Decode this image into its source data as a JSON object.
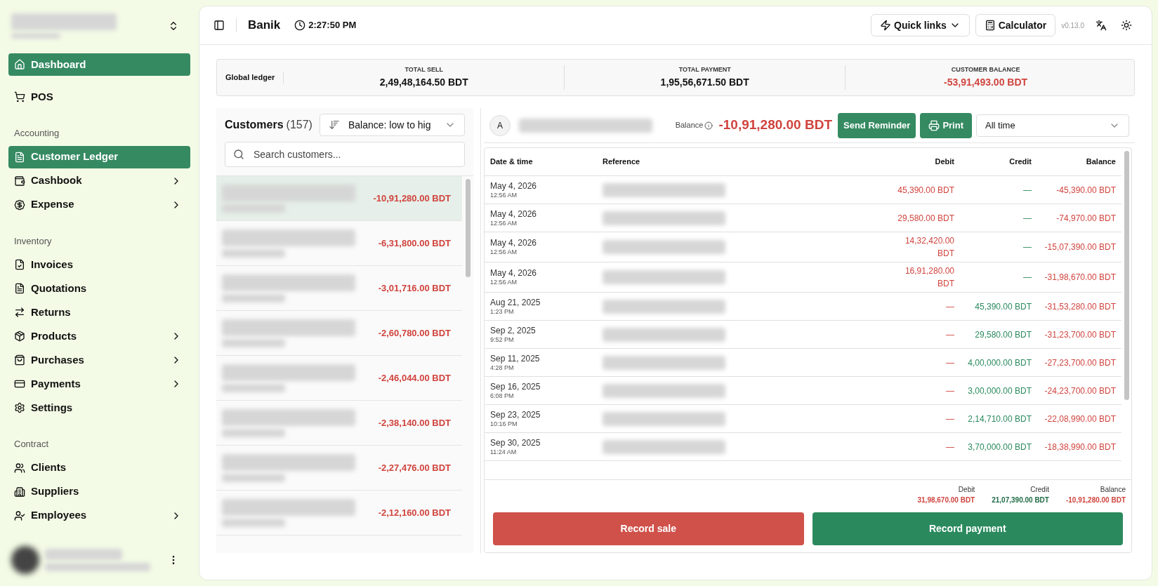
{
  "sidebar": {
    "sections": [
      {
        "items": [
          {
            "label": "Dashboard",
            "selected": true,
            "has_submenu": false
          },
          {
            "label": "POS",
            "selected": false,
            "has_submenu": false
          }
        ]
      },
      {
        "heading": "Accounting",
        "items": [
          {
            "label": "Customer Ledger",
            "selected": true,
            "has_submenu": false
          },
          {
            "label": "Cashbook",
            "selected": false,
            "has_submenu": true
          },
          {
            "label": "Expense",
            "selected": false,
            "has_submenu": true
          }
        ]
      },
      {
        "heading": "Inventory",
        "items": [
          {
            "label": "Invoices",
            "selected": false,
            "has_submenu": false
          },
          {
            "label": "Quotations",
            "selected": false,
            "has_submenu": false
          },
          {
            "label": "Returns",
            "selected": false,
            "has_submenu": false
          },
          {
            "label": "Products",
            "selected": false,
            "has_submenu": true
          },
          {
            "label": "Purchases",
            "selected": false,
            "has_submenu": true
          },
          {
            "label": "Payments",
            "selected": false,
            "has_submenu": true
          },
          {
            "label": "Settings",
            "selected": false,
            "has_submenu": false
          }
        ]
      },
      {
        "heading": "Contract",
        "items": [
          {
            "label": "Clients",
            "selected": false,
            "has_submenu": false
          },
          {
            "label": "Suppliers",
            "selected": false,
            "has_submenu": false
          },
          {
            "label": "Employees",
            "selected": false,
            "has_submenu": true
          }
        ]
      }
    ]
  },
  "topbar": {
    "title": "Banik",
    "time": "2:27:50 PM",
    "quick_links": "Quick links",
    "calculator": "Calculator",
    "version": "v0.13.0"
  },
  "summary": {
    "label": "Global ledger",
    "stats": [
      {
        "label": "TOTAL SELL",
        "value": "2,49,48,164.50 BDT",
        "negative": false
      },
      {
        "label": "TOTAL PAYMENT",
        "value": "1,95,56,671.50 BDT",
        "negative": false
      },
      {
        "label": "CUSTOMER BALANCE",
        "value": "-53,91,493.00 BDT",
        "negative": true
      }
    ]
  },
  "customers": {
    "title": "Customers",
    "count": "(157)",
    "sort": "Balance: low to hig",
    "search_placeholder": "Search customers...",
    "rows": [
      {
        "balance": "-10,91,280.00 BDT",
        "selected": true
      },
      {
        "balance": "-6,31,800.00 BDT",
        "selected": false
      },
      {
        "balance": "-3,01,716.00 BDT",
        "selected": false
      },
      {
        "balance": "-2,60,780.00 BDT",
        "selected": false
      },
      {
        "balance": "-2,46,044.00 BDT",
        "selected": false
      },
      {
        "balance": "-2,38,140.00 BDT",
        "selected": false
      },
      {
        "balance": "-2,27,476.00 BDT",
        "selected": false
      },
      {
        "balance": "-2,12,160.00 BDT",
        "selected": false
      }
    ]
  },
  "ledger": {
    "avatar": "A",
    "balance_label": "Balance",
    "balance": "-10,91,280.00 BDT",
    "send_reminder": "Send Reminder",
    "print": "Print",
    "period": "All time",
    "columns": [
      "Date & time",
      "Reference",
      "Debit",
      "Credit",
      "Balance"
    ],
    "rows": [
      {
        "date": "May 4, 2026",
        "time": "12:56 AM",
        "debit": "45,390.00 BDT",
        "credit": "—",
        "balance": "-45,390.00 BDT"
      },
      {
        "date": "May 4, 2026",
        "time": "12:56 AM",
        "debit": "29,580.00 BDT",
        "credit": "—",
        "balance": "-74,970.00 BDT"
      },
      {
        "date": "May 4, 2026",
        "time": "12:56 AM",
        "debit": "14,32,420.00 BDT",
        "credit": "—",
        "balance": "-15,07,390.00 BDT"
      },
      {
        "date": "May 4, 2026",
        "time": "12:56 AM",
        "debit": "16,91,280.00 BDT",
        "credit": "—",
        "balance": "-31,98,670.00 BDT"
      },
      {
        "date": "Aug 21, 2025",
        "time": "1:23 PM",
        "debit": "—",
        "credit": "45,390.00 BDT",
        "balance": "-31,53,280.00 BDT"
      },
      {
        "date": "Sep 2, 2025",
        "time": "9:52 PM",
        "debit": "—",
        "credit": "29,580.00 BDT",
        "balance": "-31,23,700.00 BDT"
      },
      {
        "date": "Sep 11, 2025",
        "time": "4:28 PM",
        "debit": "—",
        "credit": "4,00,000.00 BDT",
        "balance": "-27,23,700.00 BDT"
      },
      {
        "date": "Sep 16, 2025",
        "time": "6:08 PM",
        "debit": "—",
        "credit": "3,00,000.00 BDT",
        "balance": "-24,23,700.00 BDT"
      },
      {
        "date": "Sep 23, 2025",
        "time": "10:16 PM",
        "debit": "—",
        "credit": "2,14,710.00 BDT",
        "balance": "-22,08,990.00 BDT"
      },
      {
        "date": "Sep 30, 2025",
        "time": "11:24 AM",
        "debit": "—",
        "credit": "3,70,000.00 BDT",
        "balance": "-18,38,990.00 BDT"
      }
    ],
    "totals": [
      {
        "label": "Debit",
        "value": "31,98,670.00 BDT"
      },
      {
        "label": "Credit",
        "value": "21,07,390.00 BDT"
      },
      {
        "label": "Balance",
        "value": "-10,91,280.00 BDT"
      }
    ],
    "record_sale": "Record sale",
    "record_payment": "Record payment"
  }
}
